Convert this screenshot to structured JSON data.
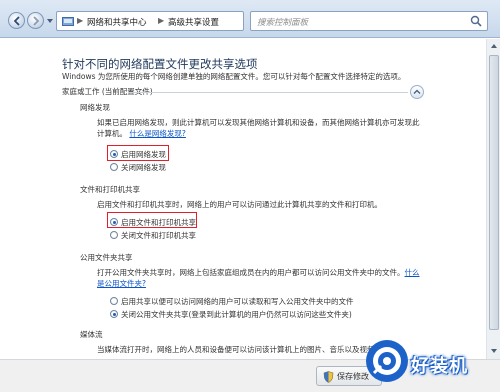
{
  "address_bar": {
    "breadcrumbs": [
      "网络和共享中心",
      "高级共享设置"
    ],
    "separator": "▶"
  },
  "search": {
    "placeholder": "搜索控制面板"
  },
  "page": {
    "title": "针对不同的网络配置文件更改共享选项",
    "description": "Windows 为您所使用的每个网络创建单独的网络配置文件。您可以针对每个配置文件选择特定的选项。"
  },
  "profile": {
    "label": "家庭或工作 (当前配置文件)"
  },
  "network_discovery": {
    "heading": "网络发现",
    "text_1": "如果已启用网络发现，则此计算机可以发现其他网络计算机和设备，而其他网络计算机亦可发现此",
    "text_2": "计算机。",
    "link": "什么是网络发现?",
    "options": [
      {
        "label": "启用网络发现",
        "selected": true
      },
      {
        "label": "关闭网络发现",
        "selected": false
      }
    ]
  },
  "file_printer_sharing": {
    "heading": "文件和打印机共享",
    "text": "启用文件和打印机共享时，网络上的用户可以访问通过此计算机共享的文件和打印机。",
    "options": [
      {
        "label": "启用文件和打印机共享",
        "selected": true
      },
      {
        "label": "关闭文件和打印机共享",
        "selected": false
      }
    ]
  },
  "public_folder_sharing": {
    "heading": "公用文件夹共享",
    "text_1": "打开公用文件夹共享时，网络上包括家庭组成员在内的用户都可以访问公用文件夹中的文件。",
    "link_1": "什么",
    "link_2": "是公用文件夹?",
    "options": [
      {
        "label": "启用共享以便可以访问网络的用户可以读取和写入公用文件夹中的文件",
        "selected": false
      },
      {
        "label": "关闭公用文件夹共享(登录到此计算机的用户仍然可以访问这些文件夹)",
        "selected": true
      }
    ]
  },
  "media_streaming": {
    "heading": "媒体流",
    "text": "当媒体流打开时，网络上的人员和设备便可以访问该计算机上的图片、音乐以及视频。"
  },
  "footer": {
    "save_label": "保存修改"
  },
  "watermark": {
    "text": "好装机"
  },
  "colors": {
    "highlight": "#e0202a",
    "link": "#0b55c4",
    "title": "#1e395b",
    "watermark": "#1d62c9"
  }
}
